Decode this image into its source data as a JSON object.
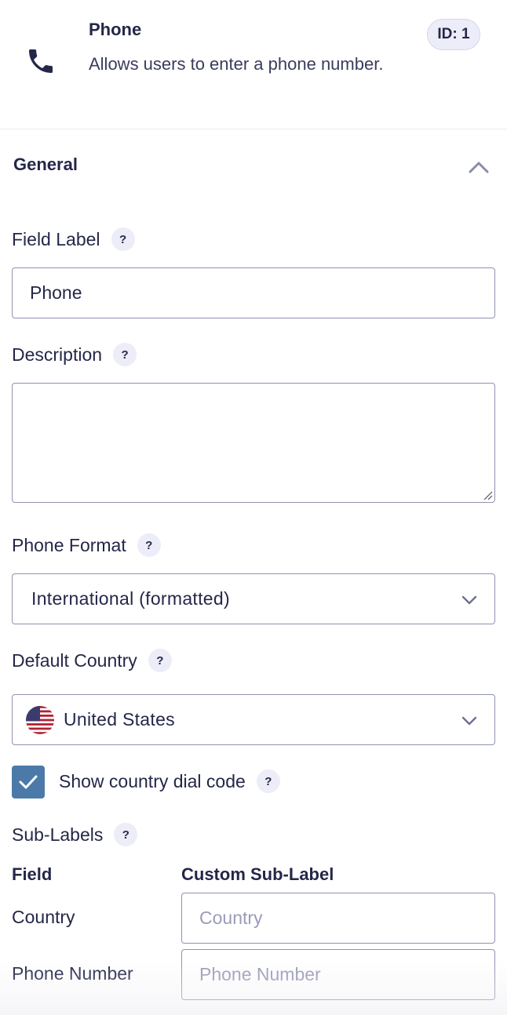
{
  "header": {
    "icon": "phone-icon",
    "title": "Phone",
    "description": "Allows users to enter a phone number.",
    "id_badge": "ID: 1"
  },
  "section": {
    "title": "General",
    "collapse_icon": "chevron-up-icon"
  },
  "fields": {
    "field_label": {
      "label": "Field Label",
      "help": "?",
      "value": "Phone"
    },
    "description": {
      "label": "Description",
      "help": "?",
      "value": ""
    },
    "phone_format": {
      "label": "Phone Format",
      "help": "?",
      "selected": "International (formatted)"
    },
    "default_country": {
      "label": "Default Country",
      "help": "?",
      "selected": "United States",
      "flag_icon": "us-flag-icon"
    },
    "show_dial_code": {
      "label": "Show country dial code",
      "help": "?",
      "checked": true
    }
  },
  "sub_labels": {
    "label": "Sub-Labels",
    "help": "?",
    "col_field": "Field",
    "col_custom": "Custom Sub-Label",
    "rows": [
      {
        "field": "Country",
        "placeholder": "Country"
      },
      {
        "field": "Phone Number",
        "placeholder": "Phone Number"
      }
    ]
  },
  "colors": {
    "text": "#242748",
    "badge_bg": "#ecedf8",
    "checkbox": "#4b7aa9",
    "border": "#9092b2"
  }
}
